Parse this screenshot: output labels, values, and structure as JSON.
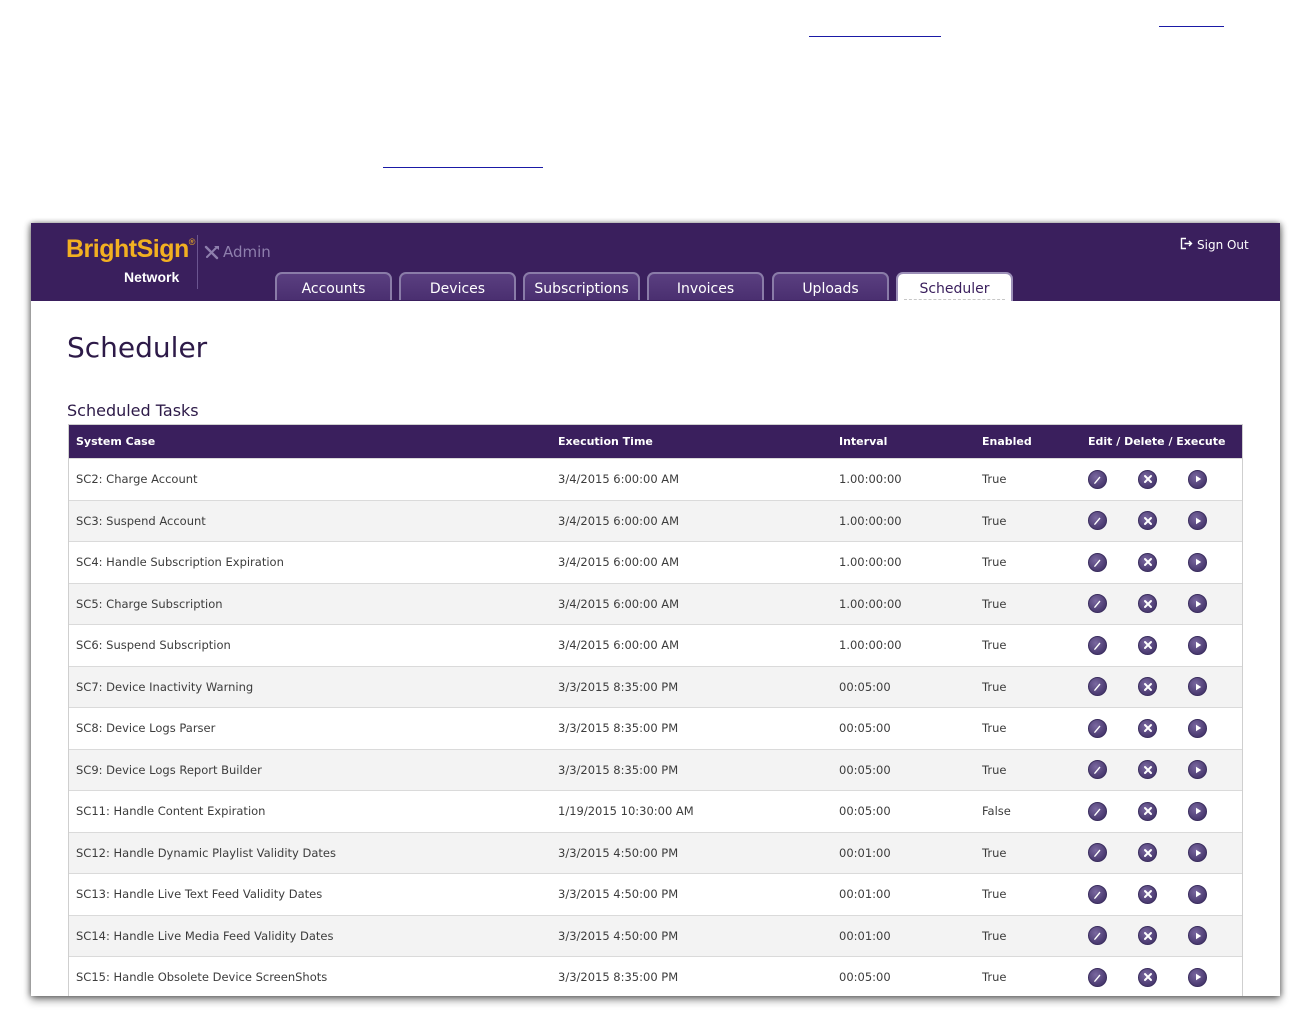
{
  "header": {
    "logo_main": "BrightSign",
    "logo_reg": "®",
    "logo_sub": "Network",
    "admin_label": "Admin",
    "sign_out_label": "Sign Out"
  },
  "tabs": [
    {
      "label": "Accounts"
    },
    {
      "label": "Devices"
    },
    {
      "label": "Subscriptions"
    },
    {
      "label": "Invoices"
    },
    {
      "label": "Uploads"
    },
    {
      "label": "Scheduler",
      "active": true
    }
  ],
  "page_title": "Scheduler",
  "section_title": "Scheduled Tasks",
  "table": {
    "columns": [
      "System Case",
      "Execution Time",
      "Interval",
      "Enabled",
      "Edit / Delete / Execute"
    ],
    "rows": [
      {
        "case": "SC2: Charge Account",
        "time": "3/4/2015 6:00:00 AM",
        "interval": "1.00:00:00",
        "enabled": "True"
      },
      {
        "case": "SC3: Suspend Account",
        "time": "3/4/2015 6:00:00 AM",
        "interval": "1.00:00:00",
        "enabled": "True"
      },
      {
        "case": "SC4: Handle Subscription Expiration",
        "time": "3/4/2015 6:00:00 AM",
        "interval": "1.00:00:00",
        "enabled": "True"
      },
      {
        "case": "SC5: Charge Subscription",
        "time": "3/4/2015 6:00:00 AM",
        "interval": "1.00:00:00",
        "enabled": "True"
      },
      {
        "case": "SC6: Suspend Subscription",
        "time": "3/4/2015 6:00:00 AM",
        "interval": "1.00:00:00",
        "enabled": "True"
      },
      {
        "case": "SC7: Device Inactivity Warning",
        "time": "3/3/2015 8:35:00 PM",
        "interval": "00:05:00",
        "enabled": "True"
      },
      {
        "case": "SC8: Device Logs Parser",
        "time": "3/3/2015 8:35:00 PM",
        "interval": "00:05:00",
        "enabled": "True"
      },
      {
        "case": "SC9: Device Logs Report Builder",
        "time": "3/3/2015 8:35:00 PM",
        "interval": "00:05:00",
        "enabled": "True"
      },
      {
        "case": "SC11: Handle Content Expiration",
        "time": "1/19/2015 10:30:00 AM",
        "interval": "00:05:00",
        "enabled": "False"
      },
      {
        "case": "SC12: Handle Dynamic Playlist Validity Dates",
        "time": "3/3/2015 4:50:00 PM",
        "interval": "00:01:00",
        "enabled": "True"
      },
      {
        "case": "SC13: Handle Live Text Feed Validity Dates",
        "time": "3/3/2015 4:50:00 PM",
        "interval": "00:01:00",
        "enabled": "True"
      },
      {
        "case": "SC14: Handle Live Media Feed Validity Dates",
        "time": "3/3/2015 4:50:00 PM",
        "interval": "00:01:00",
        "enabled": "True"
      },
      {
        "case": "SC15: Handle Obsolete Device ScreenShots",
        "time": "3/3/2015 8:35:00 PM",
        "interval": "00:05:00",
        "enabled": "True"
      }
    ]
  },
  "icons": {
    "admin": "tools-icon",
    "sign_out": "sign-out-icon",
    "edit": "edit-icon",
    "delete": "delete-icon",
    "execute": "execute-icon"
  },
  "colors": {
    "header_bg": "#3a1f5d",
    "logo_accent": "#f2b021",
    "row_alt": "#f3f3f3"
  }
}
